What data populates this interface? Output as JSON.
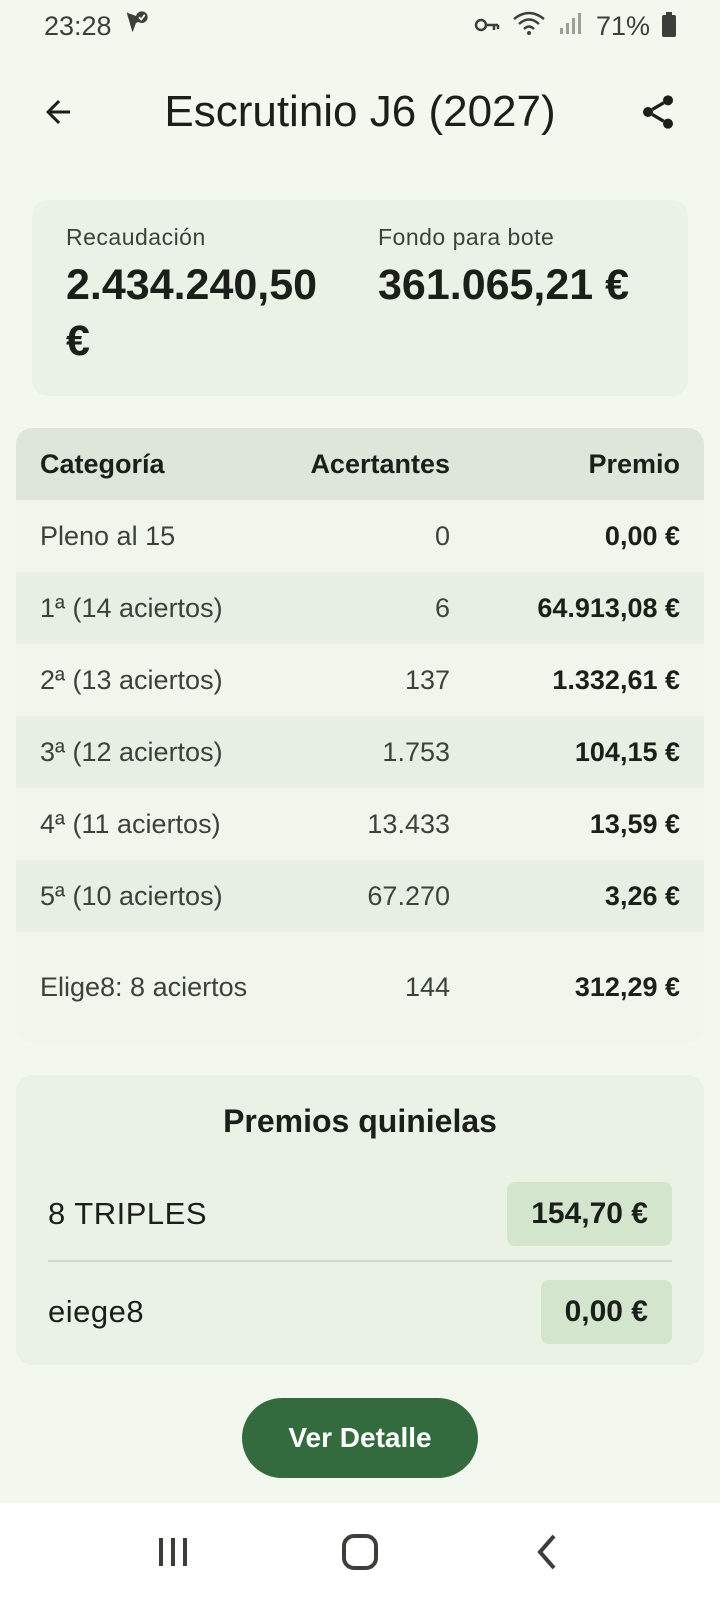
{
  "status_bar": {
    "time": "23:28",
    "battery": "71%",
    "icons": [
      "location-check-icon",
      "vpn-key-icon",
      "wifi-icon",
      "signal-icon",
      "battery-icon"
    ]
  },
  "header": {
    "title": "Escrutinio J6 (2027)",
    "back_icon": "arrow-back-icon",
    "share_icon": "share-icon"
  },
  "summary": {
    "recaudacion_label": "Recaudación",
    "recaudacion_value": "2.434.240,50 €",
    "fondo_label": "Fondo para bote",
    "fondo_value": "361.065,21 €"
  },
  "table": {
    "headers": [
      "Categoría",
      "Acertantes",
      "Premio"
    ],
    "rows": [
      {
        "categoria": "Pleno al 15",
        "acertantes": "0",
        "premio": "0,00 €"
      },
      {
        "categoria": "1ª (14 aciertos)",
        "acertantes": "6",
        "premio": "64.913,08 €"
      },
      {
        "categoria": "2ª (13 aciertos)",
        "acertantes": "137",
        "premio": "1.332,61 €"
      },
      {
        "categoria": "3ª (12 aciertos)",
        "acertantes": "1.753",
        "premio": "104,15 €"
      },
      {
        "categoria": "4ª (11 aciertos)",
        "acertantes": "13.433",
        "premio": "13,59 €"
      },
      {
        "categoria": "5ª (10 aciertos)",
        "acertantes": "67.270",
        "premio": "3,26 €"
      },
      {
        "categoria": "Elige8: 8 aciertos",
        "acertantes": "144",
        "premio": "312,29 €"
      }
    ]
  },
  "prizes": {
    "title": "Premios quinielas",
    "items": [
      {
        "name": "8 TRIPLES",
        "value": "154,70 €"
      },
      {
        "name": "eiege8",
        "value": "0,00 €"
      }
    ]
  },
  "button": {
    "label": "Ver Detalle"
  },
  "nav": {
    "icons": [
      "recents-icon",
      "home-icon",
      "back-icon"
    ]
  },
  "colors": {
    "background": "#f3f8ef",
    "accent": "#346b3e",
    "prize_chip": "#d3e6cd",
    "table_header": "#dde6d8"
  }
}
